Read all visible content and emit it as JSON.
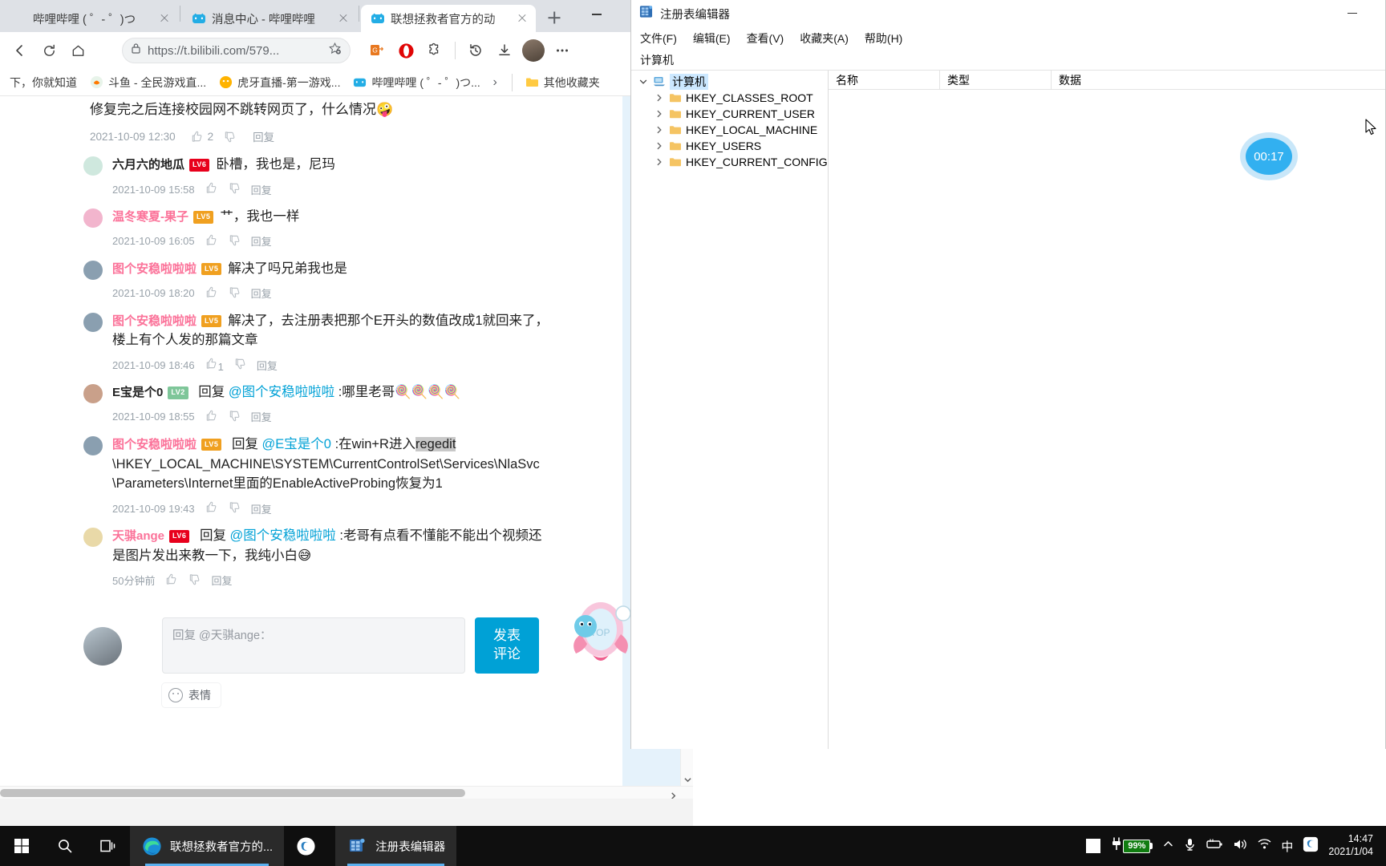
{
  "browser": {
    "tabs": [
      {
        "title": "哔哩哔哩 ( ゜- ゜)つ",
        "favicon": "bilibili-icon",
        "active": false
      },
      {
        "title": "消息中心 - 哔哩哔哩",
        "favicon": "bilibili-icon",
        "active": false
      },
      {
        "title": "联想拯救者官方的动",
        "favicon": "bilibili-icon",
        "active": true
      }
    ],
    "new_tab_label": "+",
    "window_controls": {
      "minimize": "minimize-icon",
      "maximize": "maximize-icon",
      "close": "close-icon"
    },
    "toolbar": {
      "back": "back-arrow-icon",
      "reload": "reload-icon",
      "home": "home-icon",
      "lock": "lock-icon",
      "url": "https://t.bilibili.com/579...",
      "favorite": "star-add-icon",
      "collections": "collections-icon",
      "opera_ext": "opera-icon",
      "puzzle": "extensions-icon",
      "history": "history-icon",
      "downloads": "download-icon",
      "profile": "avatar",
      "more": "more-options-icon"
    },
    "bookmarks": [
      {
        "label": "下，你就知道",
        "icon": "bookmark-icon"
      },
      {
        "label": "斗鱼 - 全民游戏直...",
        "icon": "douyu-icon"
      },
      {
        "label": "虎牙直播-第一游戏...",
        "icon": "huya-icon"
      },
      {
        "label": "哔哩哔哩 ( ゜- ゜)つ...",
        "icon": "bilibili-icon"
      }
    ],
    "bookmarks_overflow": "›",
    "other_bookmarks": {
      "label": "其他收藏夹",
      "icon": "folder-icon"
    }
  },
  "page": {
    "root_comment": {
      "text": "修复完之后连接校园网不跳转网页了，什么情况",
      "emoji": "🤪",
      "time": "2021-10-09 12:30",
      "likes": "2",
      "dislikes": "",
      "reply_label": "回复"
    },
    "replies": [
      {
        "user": "六月六的地瓜",
        "level": "LV6",
        "level_color": "#e8001c",
        "name_color": "dark",
        "prefix": "",
        "at": "",
        "text": "卧槽，我也是，尼玛",
        "text2": "",
        "time": "2021-10-09 15:58",
        "likes": "",
        "reply_label": "回复",
        "avatar_color": "#cfe8de"
      },
      {
        "user": "温冬寒夏-果子",
        "level": "LV5",
        "level_color": "#f0a020",
        "name_color": "pink",
        "prefix": "",
        "at": "",
        "text": "艹，我也一样",
        "text2": "",
        "time": "2021-10-09 16:05",
        "likes": "",
        "reply_label": "回复",
        "avatar_color": "#f2b5cd"
      },
      {
        "user": "图个安稳啦啦啦",
        "level": "LV5",
        "level_color": "#f0a020",
        "name_color": "pink",
        "prefix": "",
        "at": "",
        "text": "解决了吗兄弟我也是",
        "text2": "",
        "time": "2021-10-09 18:20",
        "likes": "",
        "reply_label": "回复",
        "avatar_color": "#8a9fb0"
      },
      {
        "user": "图个安稳啦啦啦",
        "level": "LV5",
        "level_color": "#f0a020",
        "name_color": "pink",
        "prefix": "",
        "at": "",
        "text": "解决了，去注册表把那个E开头的数值改成1就回来了，",
        "text2": "楼上有个人发的那篇文章",
        "time": "2021-10-09 18:46",
        "likes": "1",
        "reply_label": "回复",
        "avatar_color": "#8a9fb0"
      },
      {
        "user": "E宝是个0",
        "level": "LV2",
        "level_color": "#7ec699",
        "name_color": "dark",
        "prefix": "回复",
        "at": "@图个安稳啦啦啦",
        "text": ":哪里老哥🍭🍭🍭🍭",
        "text2": "",
        "time": "2021-10-09 18:55",
        "likes": "",
        "reply_label": "回复",
        "avatar_color": "#c9a08a"
      },
      {
        "user": "图个安稳啦啦啦",
        "level": "LV5",
        "level_color": "#f0a020",
        "name_color": "pink",
        "prefix": "回复",
        "at": "@E宝是个0",
        "text": ":在win+R进入",
        "highlight": "regedit",
        "text2": "\\HKEY_LOCAL_MACHINE\\SYSTEM\\CurrentControlSet\\Services\\NlaSvc",
        "text3": "\\Parameters\\Internet里面的EnableActiveProbing恢复为1",
        "time": "2021-10-09 19:43",
        "likes": "",
        "reply_label": "回复",
        "avatar_color": "#8a9fb0"
      },
      {
        "user": "天骐ange",
        "level": "LV6",
        "level_color": "#e8001c",
        "name_color": "pink",
        "prefix": "回复",
        "at": "@图个安稳啦啦啦",
        "text": ":老哥有点看不懂能不能出个视频还",
        "text2": "是图片发出来教一下，我纯小白😅",
        "time": "50分钟前",
        "likes": "",
        "reply_label": "回复",
        "avatar_color": "#e9d9a8"
      }
    ],
    "reply_form": {
      "placeholder": "回复 @天骐ange：",
      "emoji_label": "表情",
      "emoji_icon": "smiley-icon",
      "submit_label_1": "发表",
      "submit_label_2": "评论"
    },
    "mascot": "rocket-top-mascot",
    "scroll_up_icon": "scroll-up-arrow",
    "scroll_down_icon": "scroll-down-arrow",
    "hscroll_right_icon": "scroll-right-arrow"
  },
  "regedit": {
    "title": "注册表编辑器",
    "title_icon": "regedit-icon",
    "minimize_icon": "minimize-icon",
    "menu": [
      "文件(F)",
      "编辑(E)",
      "查看(V)",
      "收藏夹(A)",
      "帮助(H)"
    ],
    "address": "计算机",
    "tree_root": {
      "label": "计算机",
      "icon": "computer-icon",
      "expanded": true
    },
    "tree_items": [
      {
        "label": "HKEY_CLASSES_ROOT",
        "icon": "folder-icon"
      },
      {
        "label": "HKEY_CURRENT_USER",
        "icon": "folder-icon"
      },
      {
        "label": "HKEY_LOCAL_MACHINE",
        "icon": "folder-icon"
      },
      {
        "label": "HKEY_USERS",
        "icon": "folder-icon"
      },
      {
        "label": "HKEY_CURRENT_CONFIG",
        "icon": "folder-icon"
      }
    ],
    "columns": [
      "名称",
      "类型",
      "数据"
    ],
    "rows": []
  },
  "overlay": {
    "timer": "00:17"
  },
  "taskbar": {
    "start_icon": "start-icon",
    "search_icon": "search-icon",
    "taskview_icon": "task-view-icon",
    "items": [
      {
        "label": "联想拯救者官方的...",
        "icon": "edge-icon",
        "active": true
      },
      {
        "label": "",
        "icon": "sogou-icon",
        "active": false
      },
      {
        "label": "注册表编辑器",
        "icon": "regedit-icon",
        "active": true
      }
    ],
    "tray": {
      "battery_percent": "99%",
      "chevron_icon": "chevron-up-icon",
      "mic_icon": "microphone-icon",
      "battery_icon": "battery-charging-icon",
      "volume_icon": "volume-icon",
      "network_icon": "network-icon",
      "ime_label": "中",
      "sogou_icon": "sogou-icon",
      "time": "14:47",
      "date": "2021/1/04",
      "notif_icon": "notification-icon"
    }
  }
}
